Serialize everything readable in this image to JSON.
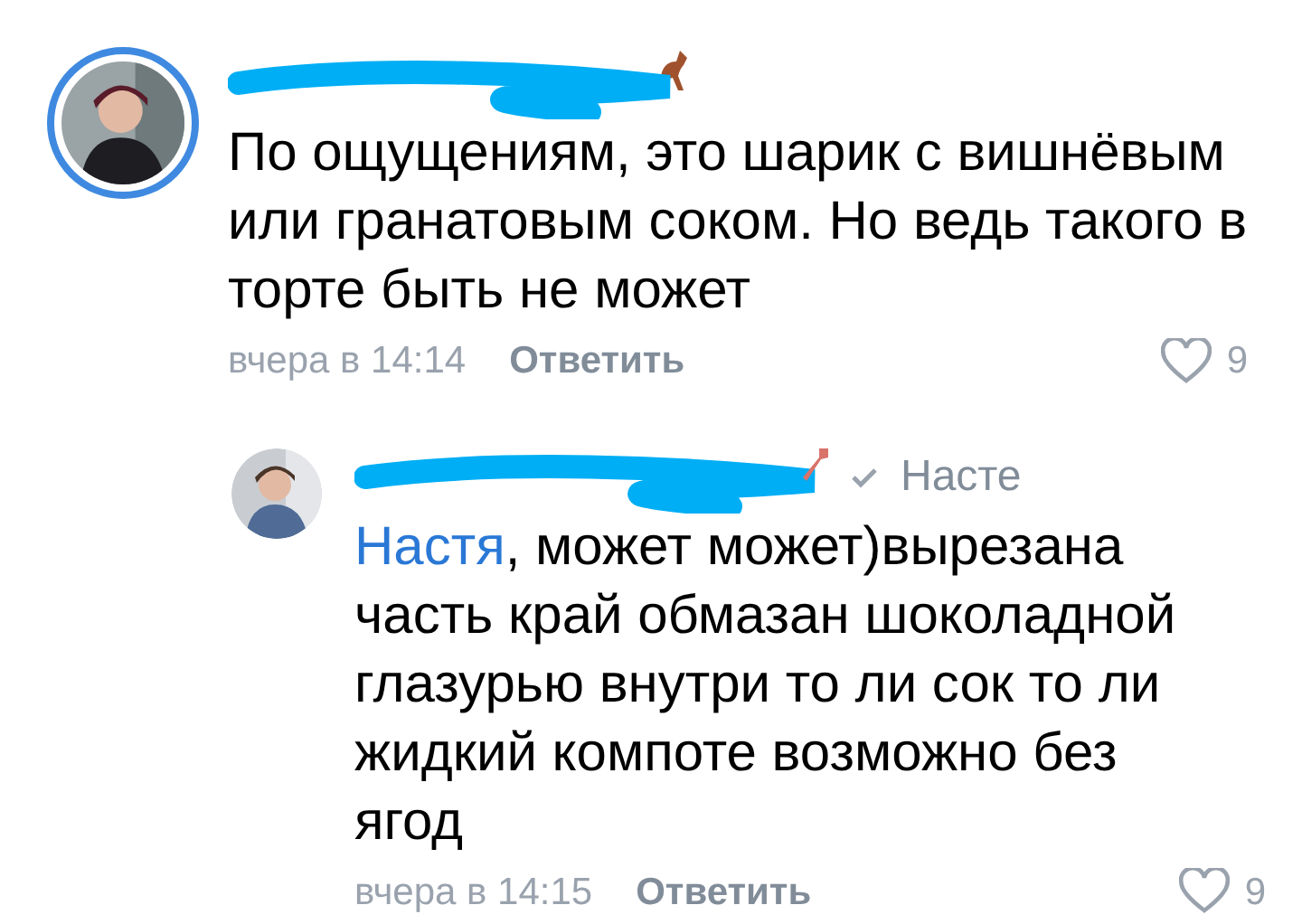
{
  "comments": [
    {
      "avatar_ring": true,
      "text": "По ощущениям, это шарик с вишнёвым или гранатовым соком. Но ведь такого в торте быть не может",
      "time": "вчера в 14:14",
      "reply_label": "Ответить",
      "likes": "9"
    },
    {
      "avatar_ring": false,
      "addressee_link": "Настя",
      "text_rest": ", может может)вырезана часть край обмазан шоколадной глазурью внутри то ли сок то ли жидкий компоте возможно без ягод",
      "time": "вчера в 14:15",
      "reply_label": "Ответить",
      "likes": "9",
      "reply_to": "Насте"
    }
  ]
}
